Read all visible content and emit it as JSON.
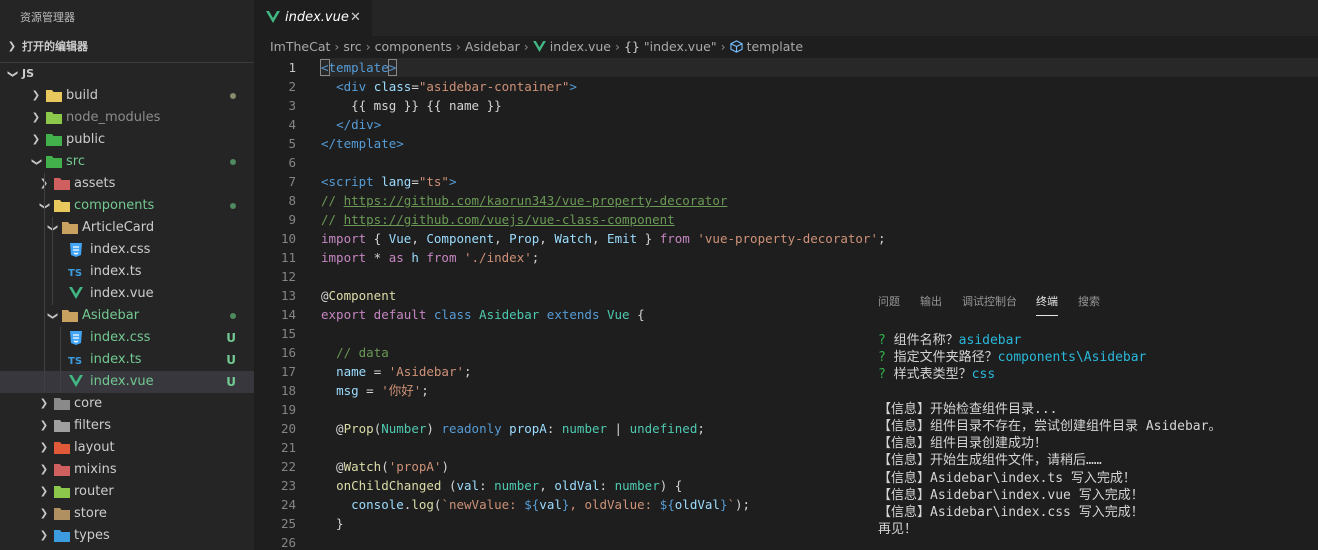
{
  "sidebar": {
    "title": "资源管理器",
    "open_editors": "打开的编辑器",
    "workspace": "JS",
    "tree": [
      {
        "label": "build",
        "level": 1,
        "type": "folder",
        "expanded": false,
        "status": "dot",
        "color": "#cccccc",
        "icon": "#e8c85c",
        "dot": "#8a8a6a"
      },
      {
        "label": "node_modules",
        "level": 1,
        "type": "folder",
        "expanded": false,
        "status": "none",
        "color": "#8c8c8c",
        "icon": "#8cc84b"
      },
      {
        "label": "public",
        "level": 1,
        "type": "folder",
        "expanded": false,
        "status": "none",
        "color": "#cccccc",
        "icon": "#43b14b"
      },
      {
        "label": "src",
        "level": 1,
        "type": "folder",
        "expanded": true,
        "status": "dot",
        "color": "#73c991",
        "icon": "#43b14b",
        "dot": "#4d8a5e"
      },
      {
        "label": "assets",
        "level": 2,
        "type": "folder",
        "expanded": false,
        "status": "none",
        "color": "#cccccc",
        "icon": "#d06060"
      },
      {
        "label": "components",
        "level": 2,
        "type": "folder",
        "expanded": true,
        "status": "dot",
        "color": "#73c991",
        "icon": "#e8c85c",
        "dot": "#4d8a5e"
      },
      {
        "label": "ArticleCard",
        "level": 3,
        "type": "folder",
        "expanded": true,
        "status": "none",
        "color": "#cccccc",
        "icon": "#c8a060"
      },
      {
        "label": "index.css",
        "level": 4,
        "type": "css",
        "status": "none",
        "color": "#cccccc",
        "icon": "#42a5f5"
      },
      {
        "label": "index.ts",
        "level": 4,
        "type": "ts",
        "status": "none",
        "color": "#cccccc",
        "icon": "#3d9be0"
      },
      {
        "label": "index.vue",
        "level": 4,
        "type": "vue",
        "status": "none",
        "color": "#cccccc",
        "icon": "#41b883"
      },
      {
        "label": "Asidebar",
        "level": 3,
        "type": "folder",
        "expanded": true,
        "status": "dot",
        "color": "#73c991",
        "icon": "#c8a060",
        "dot": "#4d8a5e"
      },
      {
        "label": "index.css",
        "level": 4,
        "type": "css",
        "status": "U",
        "color": "#73c991",
        "icon": "#42a5f5"
      },
      {
        "label": "index.ts",
        "level": 4,
        "type": "ts",
        "status": "U",
        "color": "#73c991",
        "icon": "#3d9be0"
      },
      {
        "label": "index.vue",
        "level": 4,
        "type": "vue",
        "status": "U",
        "color": "#73c991",
        "icon": "#41b883",
        "active": true
      },
      {
        "label": "core",
        "level": 2,
        "type": "folder",
        "expanded": false,
        "status": "none",
        "color": "#cccccc",
        "icon": "#8a8a8a"
      },
      {
        "label": "filters",
        "level": 2,
        "type": "folder",
        "expanded": false,
        "status": "none",
        "color": "#cccccc",
        "icon": "#a0a0a0"
      },
      {
        "label": "layout",
        "level": 2,
        "type": "folder",
        "expanded": false,
        "status": "none",
        "color": "#cccccc",
        "icon": "#e05a3a"
      },
      {
        "label": "mixins",
        "level": 2,
        "type": "folder",
        "expanded": false,
        "status": "none",
        "color": "#cccccc",
        "icon": "#d06060"
      },
      {
        "label": "router",
        "level": 2,
        "type": "folder",
        "expanded": false,
        "status": "none",
        "color": "#cccccc",
        "icon": "#8cc84b"
      },
      {
        "label": "store",
        "level": 2,
        "type": "folder",
        "expanded": false,
        "status": "none",
        "color": "#cccccc",
        "icon": "#b09060"
      },
      {
        "label": "types",
        "level": 2,
        "type": "folder",
        "expanded": false,
        "status": "none",
        "color": "#cccccc",
        "icon": "#3d9be0"
      }
    ]
  },
  "tab": {
    "name": "index.vue",
    "close": "✕"
  },
  "breadcrumbs": [
    {
      "text": "ImTheCat",
      "icon": ""
    },
    {
      "text": "src",
      "icon": ""
    },
    {
      "text": "components",
      "icon": ""
    },
    {
      "text": "Asidebar",
      "icon": ""
    },
    {
      "text": "index.vue",
      "icon": "vue"
    },
    {
      "text": "\"index.vue\"",
      "icon": "braces"
    },
    {
      "text": "template",
      "icon": "cube"
    }
  ],
  "editor": {
    "current_line": 1,
    "lines": [
      [
        [
          "tg",
          "<"
        ],
        [
          "tg",
          "template"
        ],
        [
          "tg",
          ">"
        ]
      ],
      [
        [
          "gb",
          "  "
        ],
        [
          "tg",
          "<div "
        ],
        [
          "at",
          "class"
        ],
        [
          "p",
          "="
        ],
        [
          "s",
          "\"asidebar-container\""
        ],
        [
          "tg",
          ">"
        ]
      ],
      [
        [
          "gb",
          "    "
        ],
        [
          "p",
          "{{ msg }} {{ name }}"
        ]
      ],
      [
        [
          "gb",
          "  "
        ],
        [
          "tg",
          "</div>"
        ]
      ],
      [
        [
          "tg",
          "</template>"
        ]
      ],
      [],
      [
        [
          "tg",
          "<script "
        ],
        [
          "at",
          "lang"
        ],
        [
          "p",
          "="
        ],
        [
          "s",
          "\"ts\""
        ],
        [
          "tg",
          ">"
        ]
      ],
      [
        [
          "cm",
          "// "
        ],
        [
          "lnk",
          "https://github.com/kaorun343/vue-property-decorator"
        ]
      ],
      [
        [
          "cm",
          "// "
        ],
        [
          "lnk",
          "https://github.com/vuejs/vue-class-component"
        ]
      ],
      [
        [
          "kw",
          "import"
        ],
        [
          "p",
          " { "
        ],
        [
          "v",
          "Vue"
        ],
        [
          "p",
          ", "
        ],
        [
          "v",
          "Component"
        ],
        [
          "p",
          ", "
        ],
        [
          "v",
          "Prop"
        ],
        [
          "p",
          ", "
        ],
        [
          "v",
          "Watch"
        ],
        [
          "p",
          ", "
        ],
        [
          "v",
          "Emit"
        ],
        [
          "p",
          " } "
        ],
        [
          "kw",
          "from"
        ],
        [
          "s",
          " 'vue-property-decorator'"
        ],
        [
          "p",
          ";"
        ]
      ],
      [
        [
          "kw",
          "import"
        ],
        [
          "p",
          " * "
        ],
        [
          "kw",
          "as"
        ],
        [
          "v",
          " h "
        ],
        [
          "kw",
          "from"
        ],
        [
          "s",
          " './index'"
        ],
        [
          "p",
          ";"
        ]
      ],
      [],
      [
        [
          "p",
          "@"
        ],
        [
          "fn",
          "Component"
        ]
      ],
      [
        [
          "kw",
          "export"
        ],
        [
          "kw",
          " default"
        ],
        [
          "k",
          " class"
        ],
        [
          "cls",
          " Asidebar"
        ],
        [
          "k",
          " extends"
        ],
        [
          "cls",
          " Vue"
        ],
        [
          "p",
          " {"
        ]
      ],
      [],
      [
        [
          "p",
          "  "
        ],
        [
          "cm",
          "// data"
        ]
      ],
      [
        [
          "p",
          "  "
        ],
        [
          "v",
          "name"
        ],
        [
          "p",
          " = "
        ],
        [
          "s",
          "'Asidebar'"
        ],
        [
          "p",
          ";"
        ]
      ],
      [
        [
          "p",
          "  "
        ],
        [
          "v",
          "msg"
        ],
        [
          "p",
          " = "
        ],
        [
          "s",
          "'你好'"
        ],
        [
          "p",
          ";"
        ]
      ],
      [],
      [
        [
          "p",
          "  @"
        ],
        [
          "fn",
          "Prop"
        ],
        [
          "p",
          "("
        ],
        [
          "cls",
          "Number"
        ],
        [
          "p",
          ") "
        ],
        [
          "k",
          "readonly"
        ],
        [
          "v",
          " propA"
        ],
        [
          "p",
          ": "
        ],
        [
          "cls",
          "number"
        ],
        [
          "p",
          " | "
        ],
        [
          "cls",
          "undefined"
        ],
        [
          "p",
          ";"
        ]
      ],
      [],
      [
        [
          "p",
          "  @"
        ],
        [
          "fn",
          "Watch"
        ],
        [
          "p",
          "("
        ],
        [
          "s",
          "'propA'"
        ],
        [
          "p",
          ")"
        ]
      ],
      [
        [
          "p",
          "  "
        ],
        [
          "fn",
          "onChildChanged"
        ],
        [
          "p",
          " ("
        ],
        [
          "v",
          "val"
        ],
        [
          "p",
          ": "
        ],
        [
          "cls",
          "number"
        ],
        [
          "p",
          ", "
        ],
        [
          "v",
          "oldVal"
        ],
        [
          "p",
          ": "
        ],
        [
          "cls",
          "number"
        ],
        [
          "p",
          ") {"
        ]
      ],
      [
        [
          "p",
          "    "
        ],
        [
          "v",
          "console"
        ],
        [
          "p",
          "."
        ],
        [
          "fn",
          "log"
        ],
        [
          "p",
          "("
        ],
        [
          "s",
          "`newValue: "
        ],
        [
          "k",
          "${"
        ],
        [
          "v",
          "val"
        ],
        [
          "k",
          "}"
        ],
        [
          "s",
          ", oldValue: "
        ],
        [
          "k",
          "${"
        ],
        [
          "v",
          "oldVal"
        ],
        [
          "k",
          "}"
        ],
        [
          "s",
          "`"
        ],
        [
          "p",
          ");"
        ]
      ],
      [
        [
          "p",
          "  }"
        ]
      ],
      []
    ]
  },
  "panel": {
    "tabs": [
      "问题",
      "输出",
      "调试控制台",
      "终端",
      "搜索"
    ],
    "active_tab": 3,
    "terminal": [
      [
        [
          "tq",
          "? "
        ],
        [
          "p",
          "组件名称？"
        ],
        [
          "tc",
          "asidebar"
        ]
      ],
      [
        [
          "tq",
          "? "
        ],
        [
          "p",
          "指定文件夹路径？"
        ],
        [
          "tc",
          "components\\Asidebar"
        ]
      ],
      [
        [
          "tq",
          "? "
        ],
        [
          "p",
          "样式表类型？"
        ],
        [
          "tc",
          "css"
        ]
      ],
      [],
      [
        [
          "p",
          "【信息】开始检查组件目录..."
        ]
      ],
      [
        [
          "p",
          "【信息】组件目录不存在，尝试创建组件目录 Asidebar。"
        ]
      ],
      [
        [
          "p",
          "【信息】组件目录创建成功！"
        ]
      ],
      [
        [
          "p",
          "【信息】开始生成组件文件，请稍后……"
        ]
      ],
      [
        [
          "p",
          "【信息】Asidebar\\index.ts 写入完成！"
        ]
      ],
      [
        [
          "p",
          "【信息】Asidebar\\index.vue 写入完成！"
        ]
      ],
      [
        [
          "p",
          "【信息】Asidebar\\index.css 写入完成！"
        ]
      ],
      [
        [
          "p",
          "再见！"
        ]
      ]
    ]
  }
}
